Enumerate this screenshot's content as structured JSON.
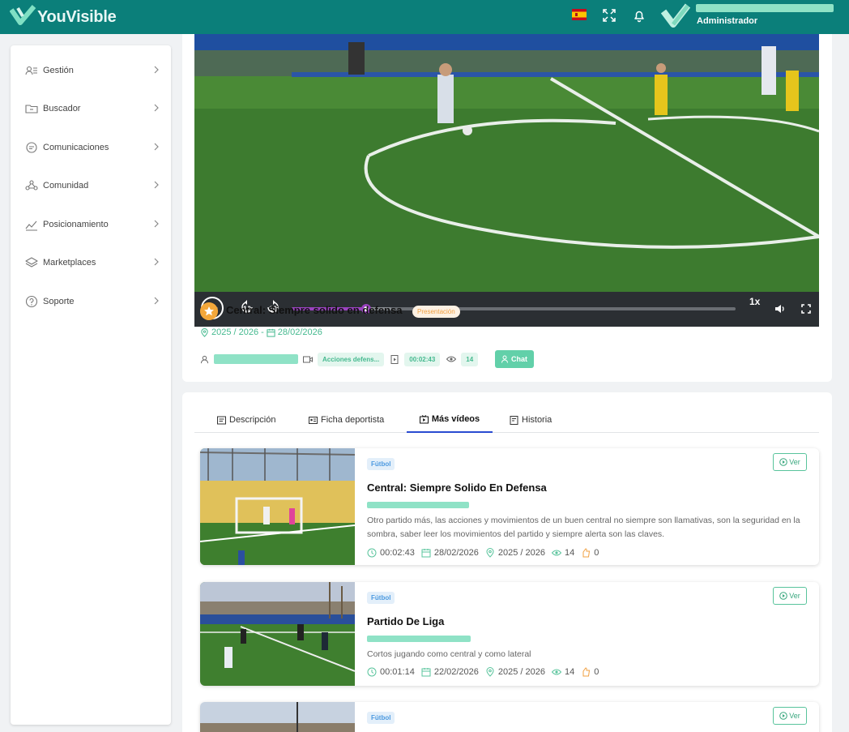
{
  "app": {
    "name": "YouVisible"
  },
  "topbar": {
    "user_email": "...",
    "user_role": "Administrador",
    "icons": [
      "spain-flag-icon",
      "fullscreen-icon",
      "bell-icon",
      "avatar"
    ]
  },
  "sidebar": {
    "items": [
      {
        "label": "Gestión",
        "icon": "users-list-icon"
      },
      {
        "label": "Buscador",
        "icon": "folder-search-icon"
      },
      {
        "label": "Comunicaciones",
        "icon": "chat-icon"
      },
      {
        "label": "Comunidad",
        "icon": "community-icon"
      },
      {
        "label": "Posicionamiento",
        "icon": "trend-icon"
      },
      {
        "label": "Marketplaces",
        "icon": "layers-icon"
      },
      {
        "label": "Soporte",
        "icon": "help-icon"
      }
    ]
  },
  "player": {
    "speed": "1x",
    "skip_back": "10",
    "skip_fwd": "10",
    "progress": 0.168,
    "buffered": 0.225
  },
  "video": {
    "title": "Central: Siempre solido en defensa",
    "badge": "Presentación",
    "season": "2025 / 2026",
    "separator": "-",
    "date": "28/02/2026",
    "category_chip": "Acciones defens...",
    "duration_chip": "00:02:43",
    "views_chip": "14",
    "chat_label": "Chat"
  },
  "tabs": [
    {
      "label": "Descripción",
      "icon": "description-icon",
      "active": false
    },
    {
      "label": "Ficha deportista",
      "icon": "id-card-icon",
      "active": false
    },
    {
      "label": "Más vídeos",
      "icon": "video-icon",
      "active": true
    },
    {
      "label": "Historia",
      "icon": "history-icon",
      "active": false
    }
  ],
  "more_videos": [
    {
      "sport": "Fútbol",
      "ver": "Ver",
      "title": "Central: Siempre Solido En Defensa",
      "description": "Otro partido más, las acciones y movimientos de un buen central no siempre son llamativas, son la seguridad en la sombra, saber leer los movimientos del partido y siempre alerta son las claves.",
      "duration": "00:02:43",
      "date": "28/02/2026",
      "season": "2025 / 2026",
      "views": "14",
      "likes": "0"
    },
    {
      "sport": "Fútbol",
      "ver": "Ver",
      "title": "Partido De Liga",
      "description": "Cortos jugando como central y como lateral",
      "duration": "00:01:14",
      "date": "22/02/2026",
      "season": "2025 / 2026",
      "views": "14",
      "likes": "0"
    },
    {
      "sport": "Fútbol",
      "ver": "Ver"
    }
  ],
  "colors": {
    "topbar": "#0b7f7a",
    "accent_green": "#45b98f",
    "progress": "#9b43c0",
    "active_tab": "#2a4cd1"
  }
}
